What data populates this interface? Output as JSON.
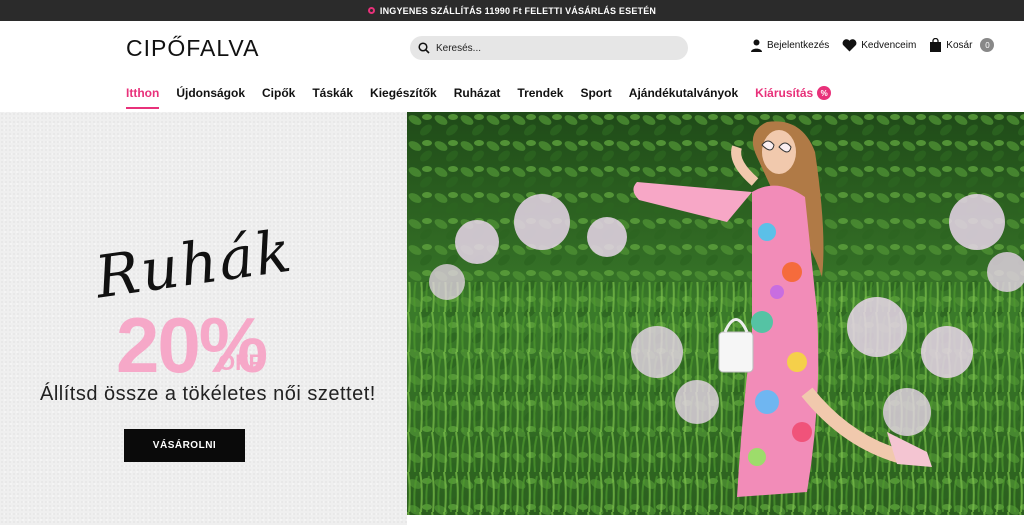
{
  "topbar": {
    "text": "INGYENES SZÁLLÍTÁS 11990 Ft FELETTI VÁSÁRLÁS ESETÉN"
  },
  "header": {
    "logo": "CIPŐFALVA",
    "search_placeholder": "Keresés...",
    "login_label": "Bejelentkezés",
    "favorites_label": "Kedvenceim",
    "cart_label": "Kosár",
    "cart_count": "0"
  },
  "nav": {
    "items": [
      "Itthon",
      "Újdonságok",
      "Cipők",
      "Táskák",
      "Kiegészítők",
      "Ruházat",
      "Trendek",
      "Sport",
      "Ajándékutalványok",
      "Kiárusítás"
    ],
    "sale_badge": "%"
  },
  "hero": {
    "script_title": "Ruhák",
    "discount": "20%",
    "off": "OFF",
    "tagline": "Állítsd össze a tökéletes női szettet!",
    "cta": "VÁSÁROLNI"
  },
  "colors": {
    "accent": "#e8317a",
    "promo_pink": "#f6a8c8",
    "topbar": "#2b2b2b"
  }
}
